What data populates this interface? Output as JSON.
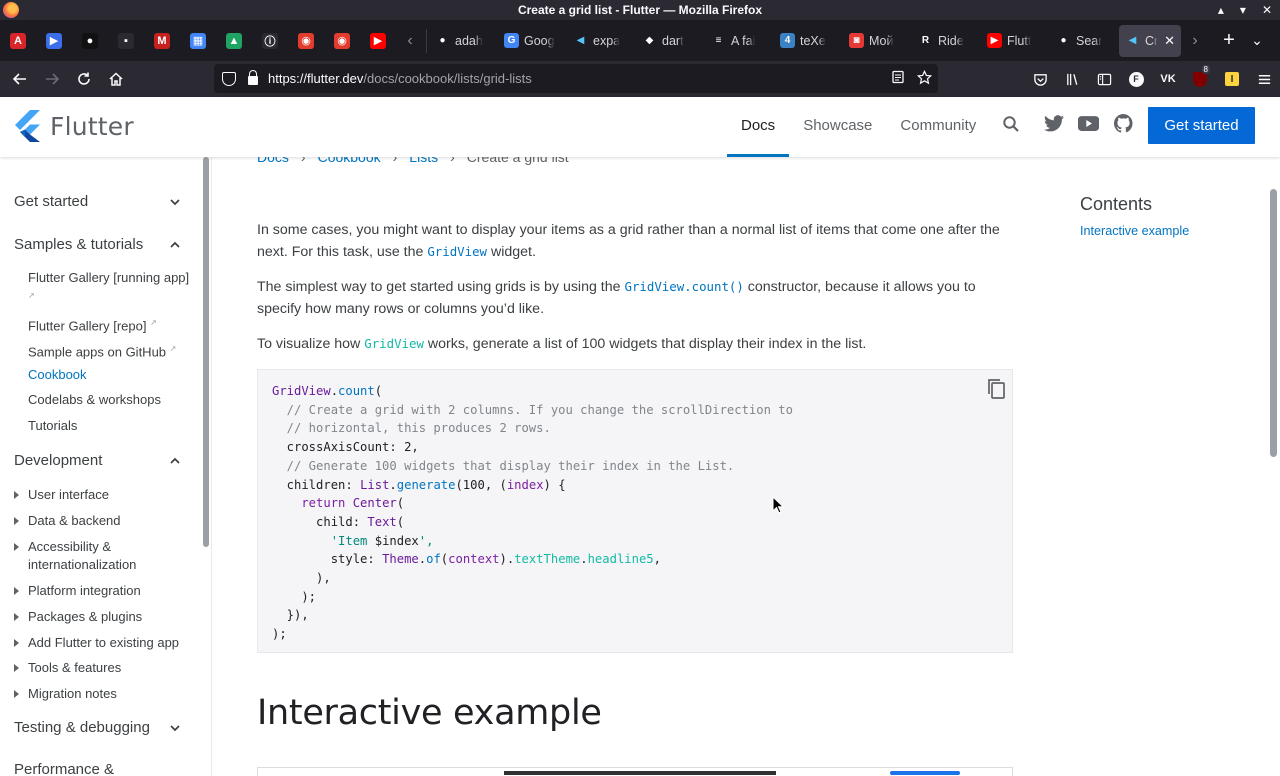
{
  "window": {
    "title": "Create a grid list - Flutter — Mozilla Firefox",
    "controls": [
      "▴",
      "▾",
      "✕"
    ]
  },
  "tabs": {
    "pinned": [
      {
        "icon": "acrobat-icon",
        "glyph": "A",
        "color": "#d9252a"
      },
      {
        "icon": "app-icon",
        "glyph": "▶",
        "color": "#3b6ee8"
      },
      {
        "icon": "chat-icon",
        "glyph": "●",
        "color": "#111111"
      },
      {
        "icon": "square-icon",
        "glyph": "▪",
        "color": "#2b2a33"
      },
      {
        "icon": "gmail-icon",
        "glyph": "M",
        "color": "#c5221f"
      },
      {
        "icon": "calendar-icon",
        "glyph": "▦",
        "color": "#4285f4"
      },
      {
        "icon": "drive-icon",
        "glyph": "▲",
        "color": "#1fa463"
      },
      {
        "icon": "info-icon",
        "glyph": "ⓘ",
        "color": "#2b2a33"
      },
      {
        "icon": "opera-icon",
        "glyph": "◉",
        "color": "#e33b2e"
      },
      {
        "icon": "opera-icon-2",
        "glyph": "◉",
        "color": "#e33b2e"
      },
      {
        "icon": "youtube-icon",
        "glyph": "▶",
        "color": "#ff0000"
      }
    ],
    "items": [
      {
        "label": "adah",
        "icon": "github-icon",
        "color": "#1c1b22",
        "glyph": "●"
      },
      {
        "label": "Goog",
        "icon": "translate-icon",
        "color": "#4285f4",
        "glyph": "G"
      },
      {
        "label": "expa",
        "icon": "flutter-icon",
        "color": "#1c1b22",
        "glyph": "◀"
      },
      {
        "label": "dart",
        "icon": "dart-icon",
        "color": "#1c1b22",
        "glyph": "◆"
      },
      {
        "label": "A fai",
        "icon": "stack-icon",
        "color": "#1c1b22",
        "glyph": "≡"
      },
      {
        "label": "teXe",
        "icon": "tex-icon",
        "color": "#3b82c4",
        "glyph": "4"
      },
      {
        "label": "Мой",
        "icon": "shop-icon",
        "color": "#e53935",
        "glyph": "◙"
      },
      {
        "label": "Ride",
        "icon": "rider-icon",
        "color": "#1c1b22",
        "glyph": "R"
      },
      {
        "label": "Flutt",
        "icon": "youtube-icon",
        "color": "#ff0000",
        "glyph": "▶"
      },
      {
        "label": "Sear",
        "icon": "github-icon",
        "color": "#1c1b22",
        "glyph": "●"
      },
      {
        "label": "Cr",
        "icon": "flutter-icon",
        "color": "#42414d",
        "glyph": "◀",
        "active": true
      }
    ],
    "new_tab": "+",
    "list_all": "⌄"
  },
  "navbar": {
    "url_host": "https://flutter.dev",
    "url_path": "/docs/cookbook/lists/grid-lists",
    "extensions_badge": "8"
  },
  "site": {
    "logo_text": "Flutter",
    "nav": [
      {
        "label": "Docs",
        "active": true
      },
      {
        "label": "Showcase"
      },
      {
        "label": "Community"
      }
    ],
    "cta": "Get started"
  },
  "breadcrumb": [
    "Docs",
    "Cookbook",
    "Lists",
    "Create a grid list"
  ],
  "sidebar": {
    "sections": [
      {
        "label": "Get started",
        "expanded": false
      },
      {
        "label": "Samples & tutorials",
        "expanded": true
      },
      {
        "label": "Development",
        "expanded": true
      },
      {
        "label": "Testing & debugging",
        "expanded": false
      },
      {
        "label": "Performance &"
      }
    ],
    "samples": [
      "Flutter Gallery [running app]",
      "Flutter Gallery [repo]",
      "Sample apps on GitHub",
      "Cookbook",
      "Codelabs & workshops",
      "Tutorials"
    ],
    "development": [
      "User interface",
      "Data & backend",
      "Accessibility &",
      "internationalization",
      "Platform integration",
      "Packages & plugins",
      "Add Flutter to existing app",
      "Tools & features",
      "Migration notes"
    ]
  },
  "content": {
    "p1_a": "In some cases, you might want to display your items as a grid rather than a normal list of items that come one after the",
    "p1_b": "next. For this task, use the ",
    "p1_code": "GridView",
    "p1_c": " widget.",
    "p2_a": "The simplest way to get started using grids is by using the ",
    "p2_code": "GridView.count()",
    "p2_b": " constructor, because it allows you to",
    "p2_c": "specify how many rows or columns you’d like.",
    "p3_a": "To visualize how ",
    "p3_code": "GridView",
    "p3_b": " works, generate a list of 100 widgets that display their index in the list.",
    "heading": "Interactive example"
  },
  "code": {
    "l1_a": "GridView",
    "l1_b": ".",
    "l1_c": "count",
    "l1_d": "(",
    "l2": "  // Create a grid with 2 columns. If you change the scrollDirection to",
    "l3": "  // horizontal, this produces 2 rows.",
    "l4_a": "  crossAxisCount",
    "l4_b": ": 2,",
    "l5": "  // Generate 100 widgets that display their index in the List.",
    "l6_a": "  children",
    "l6_b": ": ",
    "l6_c": "List",
    "l6_d": ".",
    "l6_e": "generate",
    "l6_f": "(100, (",
    "l6_g": "index",
    "l6_h": ") {",
    "l7_a": "    return ",
    "l7_b": "Center",
    "l7_c": "(",
    "l8_a": "      child",
    "l8_b": ": ",
    "l8_c": "Text",
    "l8_d": "(",
    "l9_a": "        'Item ",
    "l9_b": "$index",
    "l9_c": "',",
    "l10_a": "        style",
    "l10_b": ": ",
    "l10_c": "Theme",
    "l10_d": ".",
    "l10_e": "of",
    "l10_f": "(",
    "l10_g": "context",
    "l10_h": ").",
    "l10_i": "textTheme",
    "l10_j": ".",
    "l10_k": "headline5",
    "l10_l": ",",
    "l11": "      ),",
    "l12": "    );",
    "l13": "  }),",
    "l14": ");"
  },
  "toc": {
    "title": "Contents",
    "items": [
      "Interactive example"
    ]
  }
}
